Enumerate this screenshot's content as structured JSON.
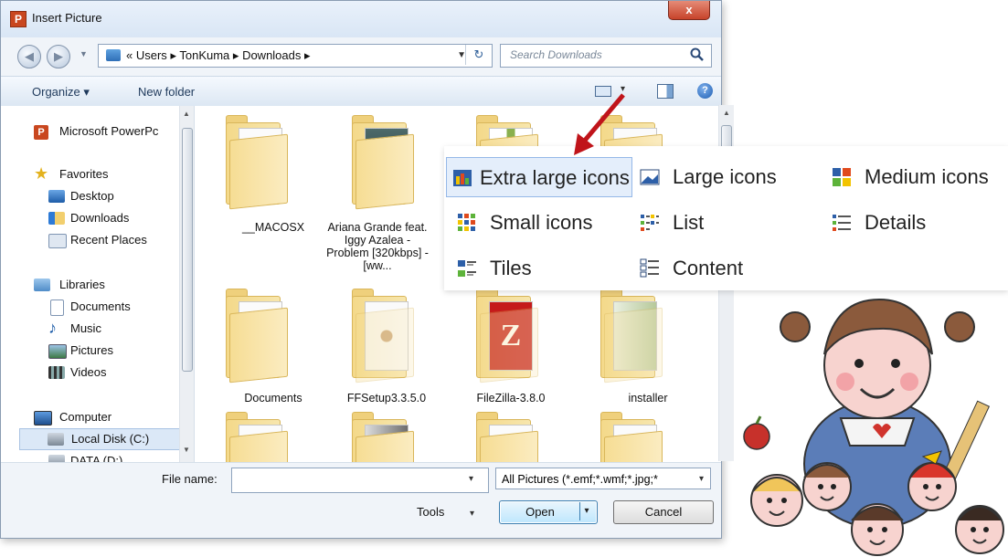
{
  "dialog": {
    "title": "Insert Picture",
    "title_icon": "P",
    "close": "x"
  },
  "address": {
    "history_overflow": "«",
    "breadcrumb": [
      "Users",
      "TonKuma",
      "Downloads"
    ],
    "separator": "▸",
    "refresh": "↻",
    "search_placeholder": "Search Downloads"
  },
  "commandbar": {
    "organize": "Organize ▾",
    "new_folder": "New folder",
    "view_dropdown": "▾",
    "help": "?"
  },
  "nav_pane": {
    "items": [
      {
        "label": "Microsoft PowerPc",
        "icon": "powerpoint-icon"
      },
      {
        "label": "Favorites",
        "icon": "star-icon"
      },
      {
        "label": "Desktop",
        "icon": "desktop-icon"
      },
      {
        "label": "Downloads",
        "icon": "downloads-icon"
      },
      {
        "label": "Recent Places",
        "icon": "recent-places-icon"
      },
      {
        "label": "Libraries",
        "icon": "libraries-icon"
      },
      {
        "label": "Documents",
        "icon": "documents-icon"
      },
      {
        "label": "Music",
        "icon": "music-icon"
      },
      {
        "label": "Pictures",
        "icon": "pictures-icon"
      },
      {
        "label": "Videos",
        "icon": "videos-icon"
      },
      {
        "label": "Computer",
        "icon": "computer-icon"
      },
      {
        "label": "Local Disk (C:)",
        "icon": "disk-icon"
      },
      {
        "label": "DATA (D:)",
        "icon": "disk-icon"
      }
    ]
  },
  "files": {
    "row1": [
      {
        "name": "__MACOSX"
      },
      {
        "name": "Ariana Grande feat. Iggy Azalea - Problem [320kbps] - [ww..."
      },
      {
        "name": ""
      },
      {
        "name": ""
      }
    ],
    "row2": [
      {
        "name": "Documents"
      },
      {
        "name": "FFSetup3.3.5.0"
      },
      {
        "name": "FileZilla-3.8.0"
      },
      {
        "name": "installer"
      }
    ]
  },
  "bottom": {
    "filename_label": "File name:",
    "filename_value": "",
    "filter": "All Pictures (*.emf;*.wmf;*.jpg;*",
    "tools": "Tools",
    "open": "Open",
    "cancel": "Cancel",
    "dropdown_glyph": "▾"
  },
  "view_menu": {
    "items": [
      {
        "label": "Extra large icons",
        "icon": "extra-large-icons-icon",
        "selected": true
      },
      {
        "label": "Large icons",
        "icon": "large-icons-icon"
      },
      {
        "label": "Medium icons",
        "icon": "medium-icons-icon"
      },
      {
        "label": "Small icons",
        "icon": "small-icons-icon"
      },
      {
        "label": "List",
        "icon": "list-icon"
      },
      {
        "label": "Details",
        "icon": "details-icon"
      },
      {
        "label": "Tiles",
        "icon": "tiles-icon"
      },
      {
        "label": "Content",
        "icon": "content-icon"
      }
    ]
  },
  "colors": {
    "arrow": "#c0141a",
    "selection": "#e4eefb",
    "folder": "#f4d98a"
  }
}
